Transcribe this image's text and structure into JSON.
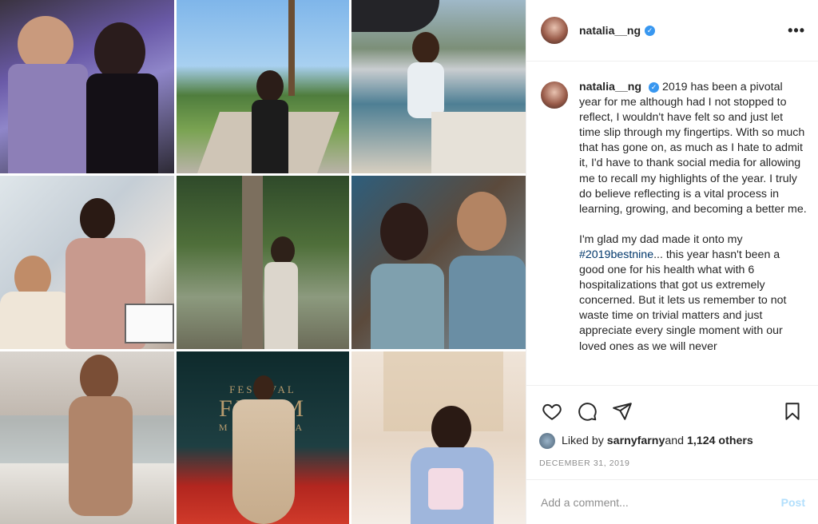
{
  "post": {
    "username": "natalia__ng",
    "verified": true,
    "more_icon": "more-horizontal-icon"
  },
  "media": {
    "festival_sign": {
      "line1": "FESTIVAL",
      "line2": "FILEM",
      "line3": "MALAYSIA"
    }
  },
  "caption": {
    "username": "natalia__ng",
    "paragraph1": "2019 has been a pivotal year for me although had I not stopped to reflect, I wouldn't have felt so and just let time slip through my fingertips. With so much that has gone on, as much as I hate to admit it, I'd have to thank social media for allowing me to recall my highlights of the year. I truly do believe reflecting is a vital process in learning, growing, and becoming a better me.",
    "paragraph2_before": "I'm glad my dad made it onto my ",
    "hashtag": "#2019bestnine",
    "paragraph2_after": "... this year hasn't been a good one for his health what with 6 hospitalizations that got us extremely concerned. But it lets us remember to not waste time on trivial matters and just appreciate every single moment with our loved ones as we will never"
  },
  "actions": {
    "like_icon": "heart-icon",
    "comment_icon": "comment-icon",
    "share_icon": "paper-plane-icon",
    "save_icon": "bookmark-icon"
  },
  "likes": {
    "prefix": "Liked by ",
    "liker": "sarnyfarny",
    "middle": " and ",
    "others": "1,124 others"
  },
  "date": "DECEMBER 31, 2019",
  "add_comment": {
    "placeholder": "Add a comment...",
    "post_label": "Post"
  },
  "colors": {
    "verified": "#3897f0",
    "hashtag": "#00376b",
    "post_disabled": "#b2dffc",
    "muted": "#8e8e8e"
  }
}
